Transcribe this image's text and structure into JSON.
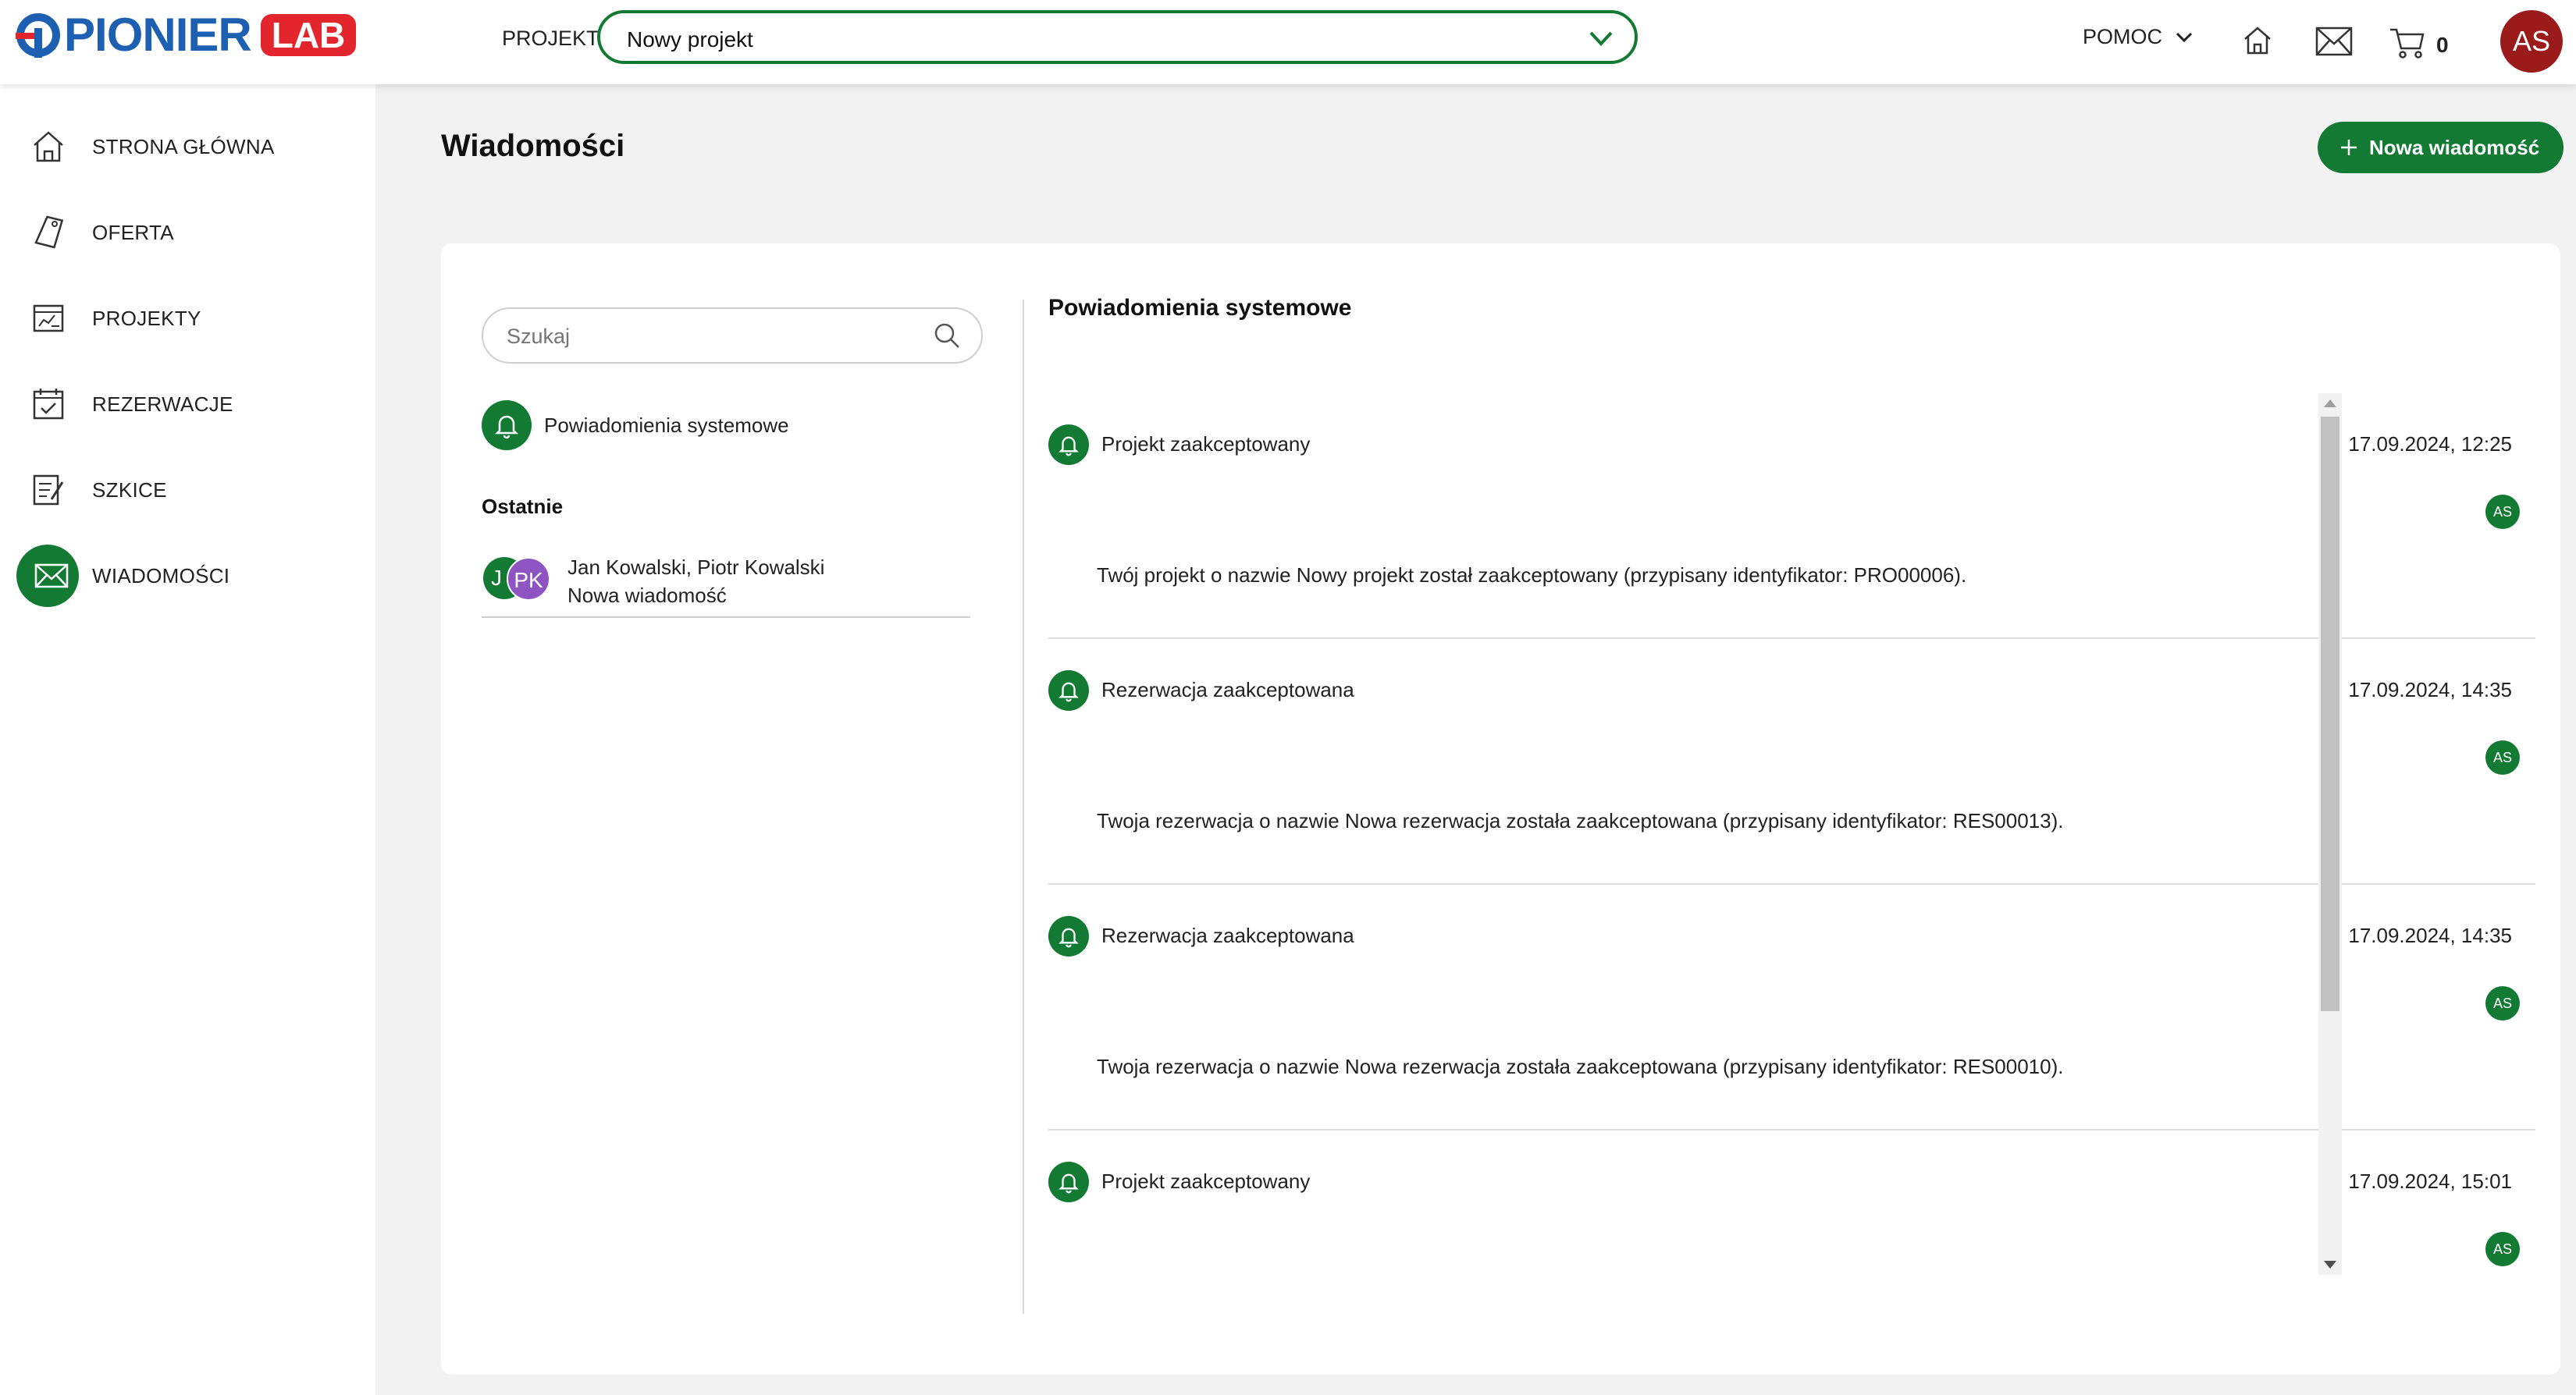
{
  "brand": {
    "name": "PIONIER",
    "lab": "LAB"
  },
  "header": {
    "project_label": "PROJEKT",
    "project_selected": "Nowy projekt",
    "help_label": "POMOC",
    "cart_count": "0",
    "user_initials": "AS"
  },
  "sidebar": {
    "items": [
      {
        "label": "STRONA GŁÓWNA",
        "icon": "home-icon"
      },
      {
        "label": "OFERTA",
        "icon": "tag-icon"
      },
      {
        "label": "PROJEKTY",
        "icon": "projects-icon"
      },
      {
        "label": "REZERWACJE",
        "icon": "calendar-icon"
      },
      {
        "label": "SZKICE",
        "icon": "draft-icon"
      },
      {
        "label": "WIADOMOŚCI",
        "icon": "mail-icon",
        "active": true
      }
    ]
  },
  "main": {
    "title": "Wiadomości",
    "new_message_label": "Nowa wiadomość",
    "search_placeholder": "Szukaj",
    "system_channel": "Powiadomienia systemowe",
    "recent_title": "Ostatnie",
    "conversation": {
      "avatar1": "J",
      "avatar2": "PK",
      "names": "Jan Kowalski, Piotr Kowalski",
      "subtitle": "Nowa wiadomość"
    },
    "thread_title": "Powiadomienia systemowe",
    "messages": [
      {
        "title": "Projekt zaakceptowany",
        "date": "17.09.2024, 12:25",
        "author": "AS",
        "body": "Twój projekt o nazwie Nowy projekt został zaakceptowany (przypisany identyfikator: PRO00006)."
      },
      {
        "title": "Rezerwacja zaakceptowana",
        "date": "17.09.2024, 14:35",
        "author": "AS",
        "body": "Twoja rezerwacja o nazwie Nowa rezerwacja została zaakceptowana (przypisany identyfikator: RES00013)."
      },
      {
        "title": "Rezerwacja zaakceptowana",
        "date": "17.09.2024, 14:35",
        "author": "AS",
        "body": "Twoja rezerwacja o nazwie Nowa rezerwacja została zaakceptowana (przypisany identyfikator: RES00010)."
      },
      {
        "title": "Projekt zaakceptowany",
        "date": "17.09.2024, 15:01",
        "author": "AS",
        "body": ""
      }
    ]
  },
  "colors": {
    "accent": "#137a34",
    "brand_blue": "#1d5fb0",
    "brand_red": "#e3262e",
    "avatar_user": "#9b1b1b",
    "avatar_pk": "#8e55c2"
  }
}
